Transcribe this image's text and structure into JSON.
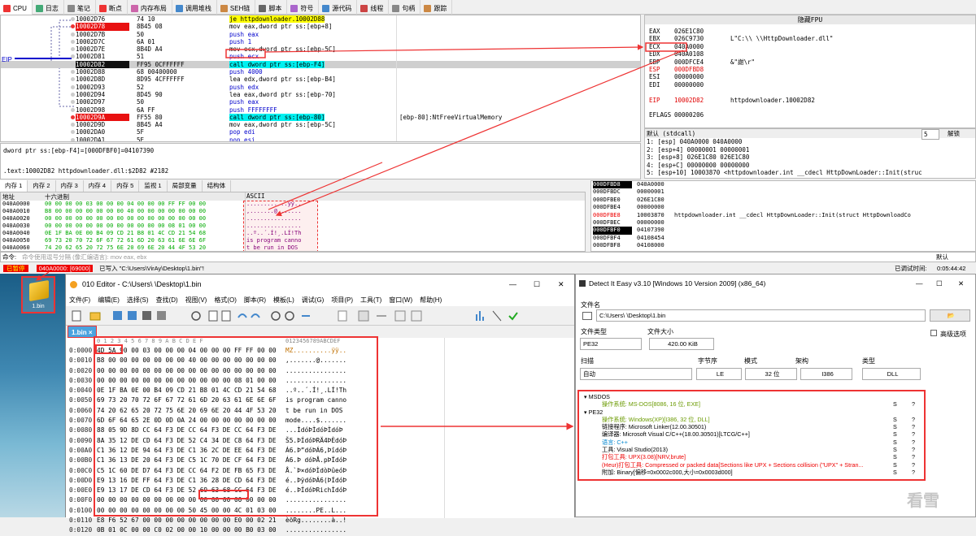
{
  "dbg": {
    "tabs": [
      {
        "label": "CPU",
        "color": "#e33"
      },
      {
        "label": "日志",
        "color": "#4a7"
      },
      {
        "label": "笔记",
        "color": "#888"
      },
      {
        "label": "断点",
        "color": "#e33"
      },
      {
        "label": "内存布局",
        "color": "#c6a"
      },
      {
        "label": "调用堆栈",
        "color": "#48c"
      },
      {
        "label": "SEH链",
        "color": "#c84"
      },
      {
        "label": "脚本",
        "color": "#666"
      },
      {
        "label": "符号",
        "color": "#a6c"
      },
      {
        "label": "源代码",
        "color": "#48c"
      },
      {
        "label": "线程",
        "color": "#c44"
      },
      {
        "label": "句柄",
        "color": "#888"
      },
      {
        "label": "跟踪",
        "color": "#c84"
      }
    ],
    "eip_label": "EIP",
    "disasm": [
      {
        "addr": "10002D76",
        "bytes": "74 10",
        "ins": "je httpdownloader.10002D88",
        "cmt": "",
        "t": "jmp"
      },
      {
        "addr": "10002D78",
        "bytes": "8B45 08",
        "ins": "mov eax,dword ptr ss:[ebp+8]",
        "cmt": "",
        "t": "mov",
        "bp": true
      },
      {
        "addr": "10002D7B",
        "bytes": "50",
        "ins": "push eax",
        "cmt": "",
        "t": "push"
      },
      {
        "addr": "10002D7C",
        "bytes": "6A 01",
        "ins": "push 1",
        "cmt": "",
        "t": "push"
      },
      {
        "addr": "10002D7E",
        "bytes": "8B4D A4",
        "ins": "mov ecx,dword ptr ss:[ebp-5C]",
        "cmt": "",
        "t": "mov"
      },
      {
        "addr": "10002D81",
        "bytes": "51",
        "ins": "push ecx",
        "cmt": "",
        "t": "push"
      },
      {
        "addr": "10002D82",
        "bytes": "FF95 0CFFFFFF",
        "ins": "call dword ptr ss:[ebp-F4]",
        "cmt": "",
        "t": "call",
        "eip": true
      },
      {
        "addr": "10002D88",
        "bytes": "68 00400000",
        "ins": "push 4000",
        "cmt": "",
        "t": "push"
      },
      {
        "addr": "10002D8D",
        "bytes": "8D95 4CFFFFFF",
        "ins": "lea edx,dword ptr ss:[ebp-B4]",
        "cmt": "",
        "t": "mov"
      },
      {
        "addr": "10002D93",
        "bytes": "52",
        "ins": "push edx",
        "cmt": "",
        "t": "push"
      },
      {
        "addr": "10002D94",
        "bytes": "8D45 90",
        "ins": "lea eax,dword ptr ss:[ebp-70]",
        "cmt": "",
        "t": "mov"
      },
      {
        "addr": "10002D97",
        "bytes": "50",
        "ins": "push eax",
        "cmt": "",
        "t": "push"
      },
      {
        "addr": "10002D98",
        "bytes": "6A FF",
        "ins": "push FFFFFFFF",
        "cmt": "",
        "t": "push"
      },
      {
        "addr": "10002D9A",
        "bytes": "FF55 80",
        "ins": "call dword ptr ss:[ebp-80]",
        "cmt": "[ebp-80]:NtFreeVirtualMemory",
        "t": "call",
        "bp": true
      },
      {
        "addr": "10002D9D",
        "bytes": "8B45 A4",
        "ins": "mov eax,dword ptr ss:[ebp-5C]",
        "cmt": "",
        "t": "mov"
      },
      {
        "addr": "10002DA0",
        "bytes": "5F",
        "ins": "pop edi",
        "cmt": "",
        "t": "push"
      },
      {
        "addr": "10002DA1",
        "bytes": "5E",
        "ins": "pop esi",
        "cmt": "",
        "t": "push"
      },
      {
        "addr": "10002DA2",
        "bytes": "8BE5",
        "ins": "mov esp,ebp",
        "cmt": "",
        "t": "mov"
      }
    ],
    "fpu_title": "隐藏FPU",
    "regs": [
      {
        "n": "EAX",
        "v": "026E1C80",
        "c": ""
      },
      {
        "n": "EBX",
        "v": "026C9730",
        "c": "L\"C:\\\\      \\\\HttpDownloader.dll\""
      },
      {
        "n": "ECX",
        "v": "040A0000",
        "c": ""
      },
      {
        "n": "EDX",
        "v": "040A0108",
        "c": ""
      },
      {
        "n": "EBP",
        "v": "000DFCE4",
        "c": "&\"謝\\r\""
      },
      {
        "n": "ESP",
        "v": "000DFBD8",
        "c": "",
        "red": true
      },
      {
        "n": "ESI",
        "v": "00000000",
        "c": ""
      },
      {
        "n": "EDI",
        "v": "00000000",
        "c": ""
      },
      {
        "n": "",
        "v": "",
        "c": ""
      },
      {
        "n": "EIP",
        "v": "10002D82",
        "c": "httpdownloader.10002D82",
        "red": true
      },
      {
        "n": "",
        "v": "",
        "c": ""
      },
      {
        "n": "EFLAGS",
        "v": "  00000206",
        "c": ""
      }
    ],
    "args_header": "默认 (stdcall)",
    "args_count": "5",
    "args_unlock": "解锁",
    "args": [
      "1: [esp] 040A0000 040A0000",
      "2: [esp+4] 00000001 00000001",
      "3: [esp+8] 026E1C80 026E1C80",
      "4: [esp+C] 00000000 00000000",
      "5: [esp+10] 10003870 <httpdownloader.int __cdecl HttpDownLoader::Init(struc"
    ],
    "info1": "dword ptr ss:[ebp-F4]=[000DFBF0]=04107390",
    "info2": ".text:10002D82 httpdownloader.dll:$2D82 #2182",
    "memtabs": [
      "内存 1",
      "内存 2",
      "内存 3",
      "内存 4",
      "内存 5",
      "监视 1",
      "局部变量",
      "结构体"
    ],
    "dump_head": {
      "addr": "地址",
      "hex": "十六进制",
      "ascii": "ASCII"
    },
    "dump": [
      {
        "a": "040A0000",
        "h": "00 00 00 00 03 00 00 00 04 00 00 00 FF FF 00 00",
        "t": "............ÿÿ.."
      },
      {
        "a": "040A0010",
        "h": "B8 00 00 00 00 00 00 00 40 00 00 00 00 00 00 00",
        "t": ",.......@......."
      },
      {
        "a": "040A0020",
        "h": "00 00 00 00 00 00 00 00 00 00 00 00 00 00 00 00",
        "t": "................"
      },
      {
        "a": "040A0030",
        "h": "00 00 00 00 00 00 00 00 00 00 00 00 08 01 00 00",
        "t": "................"
      },
      {
        "a": "040A0040",
        "h": "0E 1F BA 0E 00 B4 09 CD 21 B8 01 4C CD 21 54 68",
        "t": "..º..´.Í!¸.LÍ!Th"
      },
      {
        "a": "040A0050",
        "h": "69 73 20 70 72 6F 67 72 61 6D 20 63 61 6E 6E 6F",
        "t": "is program canno"
      },
      {
        "a": "040A0060",
        "h": "74 20 62 65 20 72 75 6E 20 69 6E 20 44 4F 53 20",
        "t": "t be run in DOS "
      }
    ],
    "stack": [
      {
        "a": "000DFBD8",
        "v": "040A0000",
        "c": "",
        "sel": true
      },
      {
        "a": "000DFBDC",
        "v": "00000001",
        "c": ""
      },
      {
        "a": "000DFBE0",
        "v": "026E1C80",
        "c": ""
      },
      {
        "a": "000DFBE4",
        "v": "00000000",
        "c": ""
      },
      {
        "a": "000DFBE8",
        "v": "10003870",
        "c": "httpdownloader.int __cdecl HttpDownLoader::Init(struct HttpDownloadCo",
        "red": true
      },
      {
        "a": "000DFBEC",
        "v": "00000000",
        "c": ""
      },
      {
        "a": "000DFBF0",
        "v": "04107390",
        "c": "",
        "sel": true
      },
      {
        "a": "000DFBF4",
        "v": "04108454",
        "c": ""
      },
      {
        "a": "000DFBF8",
        "v": "04108000",
        "c": ""
      }
    ],
    "cmd_label": "命令:",
    "cmd_placeholder": "命令使用逗号分隔 (像汇编语言): mov eax, ebx",
    "cmd_default": "默认",
    "status_paused": "已暂停",
    "status_addr": "040A0000: [69000]",
    "status_text": "已写入 \"C:\\Users\\VirAy\\Desktop\\1.bin\"!",
    "status_time_label": "已调试时间:",
    "status_time": "0:05:44:42"
  },
  "desktop": {
    "file_label": "1.bin"
  },
  "editor": {
    "title": "010 Editor - C:\\Users\\      \\Desktop\\1.bin",
    "menu": [
      "文件(F)",
      "编辑(E)",
      "选择(S)",
      "查找(D)",
      "视图(V)",
      "格式(O)",
      "脚本(R)",
      "模板(L)",
      "调试(G)",
      "项目(P)",
      "工具(T)",
      "窗口(W)",
      "帮助(H)"
    ],
    "tab": "1.bin ×",
    "header_hex": "0  1  2  3  4  5  6  7  8  9  A  B  C  D  E  F",
    "header_ascii": "0123456789ABCDEF",
    "rows": [
      {
        "a": "0:0000",
        "h": "4D 5A 90 00 03 00 00 00 04 00 00 00 FF FF 00 00",
        "t": "MZ..........ÿÿ.."
      },
      {
        "a": "0:0010",
        "h": "B8 00 00 00 00 00 00 00 40 00 00 00 00 00 00 00",
        "t": ",.......@......."
      },
      {
        "a": "0:0020",
        "h": "00 00 00 00 00 00 00 00 00 00 00 00 00 00 00 00",
        "t": "................"
      },
      {
        "a": "0:0030",
        "h": "00 00 00 00 00 00 00 00 00 00 00 00 08 01 00 00",
        "t": "................"
      },
      {
        "a": "0:0040",
        "h": "0E 1F BA 0E 00 B4 09 CD 21 B8 01 4C CD 21 54 68",
        "t": "..º..´.Í!¸.LÍ!Th"
      },
      {
        "a": "0:0050",
        "h": "69 73 20 70 72 6F 67 72 61 6D 20 63 61 6E 6E 6F",
        "t": "is program canno"
      },
      {
        "a": "0:0060",
        "h": "74 20 62 65 20 72 75 6E 20 69 6E 20 44 4F 53 20",
        "t": "t be run in DOS "
      },
      {
        "a": "0:0070",
        "h": "6D 6F 64 65 2E 0D 0D 0A 24 00 00 00 00 00 00 00",
        "t": "mode....$......."
      },
      {
        "a": "0:0080",
        "h": "88 05 9D 8D CC 64 F3 DE CC 64 F3 DE CC 64 F3 DE",
        "t": "...ÌdóÞÌdóÞÌdóÞ"
      },
      {
        "a": "0:0090",
        "h": "8A 35 12 DE CD 64 F3 DE 52 C4 34 DE C8 64 F3 DE",
        "t": "Š5.ÞÍdóÞRÄ4ÞÈdóÞ"
      },
      {
        "a": "0:00A0",
        "h": "C1 36 12 DE 94 64 F3 DE C1 36 2C DE EE 64 F3 DE",
        "t": "Á6.Þ”dóÞÁ6,ÞîdóÞ"
      },
      {
        "a": "0:00B0",
        "h": "C1 36 13 DE 20 64 F3 DE C5 1C 70 DE CF 64 F3 DE",
        "t": "Á6.Þ dóÞÅ.pÞÏdóÞ"
      },
      {
        "a": "0:00C0",
        "h": "C5 1C 60 DE D7 64 F3 DE CC 64 F2 DE FB 65 F3 DE",
        "t": "Å.`Þ×dóÞÌdòÞûeóÞ"
      },
      {
        "a": "0:00D0",
        "h": "E9 13 16 DE FF 64 F3 DE C1 36 28 DE CD 64 F3 DE",
        "t": "é..ÞÿdóÞÁ6(ÞÍdóÞ"
      },
      {
        "a": "0:00E0",
        "h": "E9 13 17 DE CD 64 F3 DE 52 69 63 68 CC 64 F3 DE",
        "t": "é..ÞÍdóÞRichÌdóÞ"
      },
      {
        "a": "0:00F0",
        "h": "00 00 00 00 00 00 00 00 00 00 00 00 00 00 00 00",
        "t": "................"
      },
      {
        "a": "0:0100",
        "h": "00 00 00 00 00 00 00 00 50 45 00 00 4C 01 03 00",
        "t": "........PE..L..."
      },
      {
        "a": "0:0110",
        "h": "E8 F6 52 67 00 00 00 00 00 00 00 00 E0 00 02 21",
        "t": "èöRg........à..!"
      },
      {
        "a": "0:0120",
        "h": "0B 01 0C 00 00 C0 02 00 00 10 00 00 00 B0 03 00",
        "t": "................"
      }
    ]
  },
  "die": {
    "title": "Detect It Easy v3.10 [Windows 10 Version 2009] (x86_64)",
    "file_label": "文件名",
    "file_value": "C:\\Users\\      \\Desktop\\1.bin",
    "type_label": "文件类型",
    "type_value": "PE32",
    "size_label": "文件大小",
    "size_value": "420.00 KiB",
    "adv_label": "高级选项",
    "scan_label": "扫描",
    "scan_value": "自动",
    "endian_label": "字节序",
    "endian_value": "LE",
    "mode_label": "模式",
    "mode_value": "32 位",
    "arch_label": "架构",
    "arch_value": "I386",
    "ftype_label": "类型",
    "ftype_value": "DLL",
    "tree": [
      {
        "t": "▾ MSDOS",
        "lvl": 0,
        "c": "#000",
        "s": "",
        "q": ""
      },
      {
        "t": "操作系统: MS-DOS[8086, 16 位, EXE]",
        "lvl": 1,
        "c": "#6a9a00",
        "s": "S",
        "q": "?"
      },
      {
        "t": "▾ PE32",
        "lvl": 0,
        "c": "#000",
        "s": "",
        "q": ""
      },
      {
        "t": "操作系统: Windows(XP)[I386, 32 位, DLL]",
        "lvl": 1,
        "c": "#6a9a00",
        "s": "S",
        "q": "?"
      },
      {
        "t": "链接程序: Microsoft Linker(12.00.30501)",
        "lvl": 1,
        "c": "#000",
        "s": "S",
        "q": "?"
      },
      {
        "t": "编译器: Microsoft Visual C/C++(18.00.30501)[LTCG/C++]",
        "lvl": 1,
        "c": "#000",
        "s": "S",
        "q": "?"
      },
      {
        "t": "语言: C++",
        "lvl": 1,
        "c": "#0a8ad0",
        "s": "S",
        "q": "?"
      },
      {
        "t": "工具: Visual Studio(2013)",
        "lvl": 1,
        "c": "#000",
        "s": "S",
        "q": "?"
      },
      {
        "t": "打包工具: UPX(3.08)[NRV,brute]",
        "lvl": 1,
        "c": "#e00",
        "s": "S",
        "q": "?"
      },
      {
        "t": "(Heur)打包工具: Compressed or packed data[Sections like UPX + Sections collision (\"UPX\" + Stran...",
        "lvl": 1,
        "c": "#e00",
        "s": "S",
        "q": "?"
      },
      {
        "t": "附加: Binary[偏移=0x0002c000,大小=0x0003d000]",
        "lvl": 1,
        "c": "#000",
        "s": "S",
        "q": "?"
      }
    ]
  }
}
